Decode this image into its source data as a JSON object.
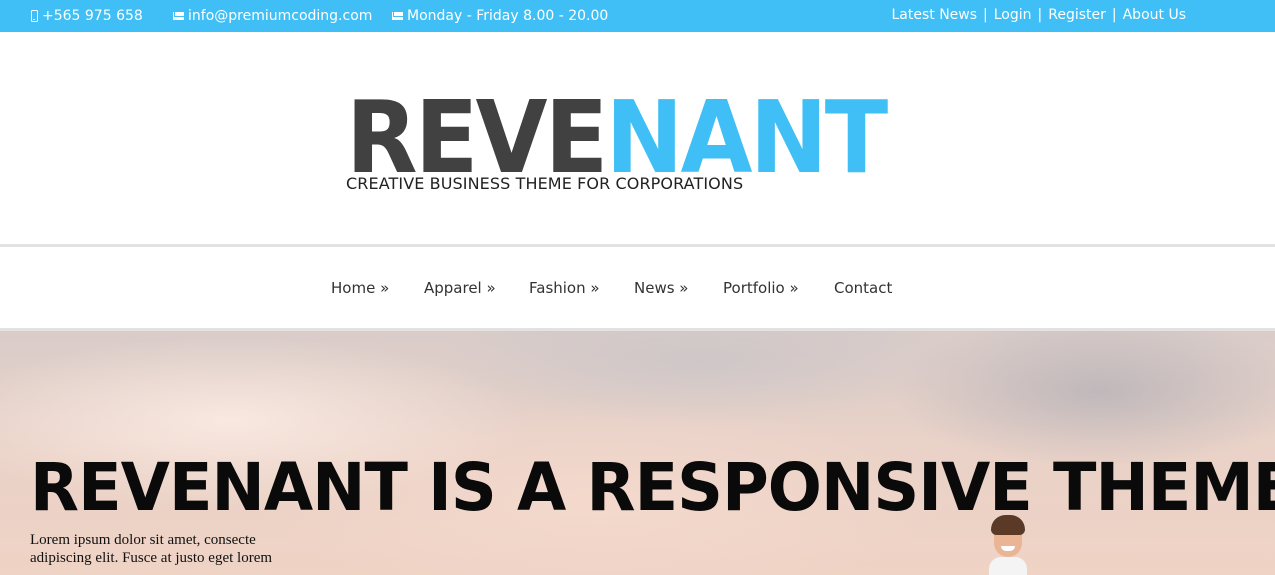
{
  "topbar": {
    "phone": "+565 975 658",
    "email": "info@premiumcoding.com",
    "hours": "Monday - Friday 8.00 - 20.00",
    "links": [
      "Latest News",
      "Login",
      "Register",
      "About Us"
    ],
    "separator": "|",
    "background_color": "#3fbff5",
    "icons": {
      "phone": "phone-icon",
      "email": "mail-icon",
      "hours": "mail-icon"
    }
  },
  "logo": {
    "word_dark": "REVE",
    "word_blue": "NANT",
    "tagline": "CREATIVE BUSINESS THEME FOR CORPORATIONS",
    "colors": {
      "dark": "#414141",
      "blue": "#3fbff5"
    }
  },
  "nav": {
    "items": [
      "Home »",
      "Apparel »",
      "Fashion »",
      "News »",
      "Portfolio »",
      "Contact"
    ]
  },
  "hero": {
    "title": "REVENANT IS A RESPONSIVE THEME",
    "text": "Lorem ipsum dolor sit amet, consecte adipiscing elit. Fusce at justo eget lorem"
  }
}
